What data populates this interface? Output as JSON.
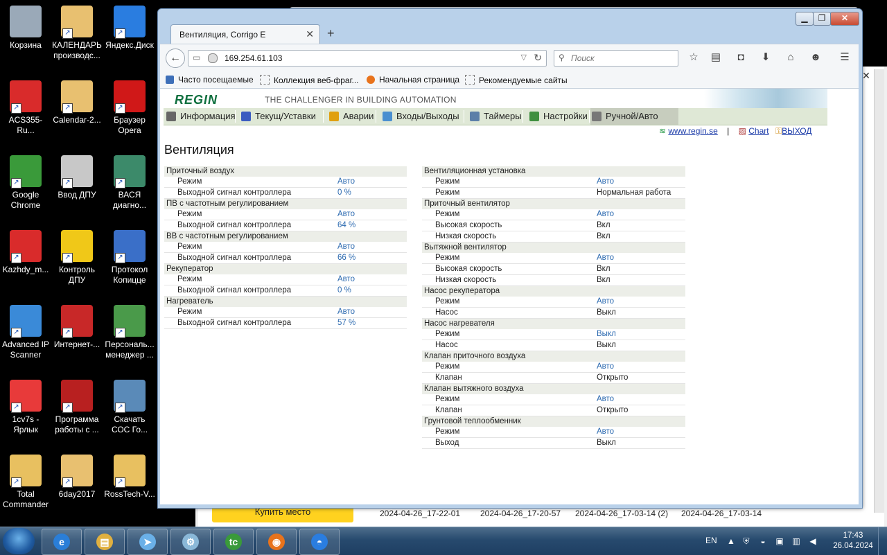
{
  "desktop": {
    "icons": [
      {
        "label": "Корзина",
        "icon": "recycle-bin-icon"
      },
      {
        "label": "КАЛЕНДАРЬ производс...",
        "icon": "calendar-file-icon"
      },
      {
        "label": "Яндекс.Диск",
        "icon": "yandex-disk-icon"
      },
      {
        "label": "ACS355-Ru...",
        "icon": "pdf-icon"
      },
      {
        "label": "Calendar-2...",
        "icon": "calendar-file-icon"
      },
      {
        "label": "Браузер Opera",
        "icon": "opera-icon"
      },
      {
        "label": "Google Chrome",
        "icon": "chrome-icon"
      },
      {
        "label": "Ввод ДПУ",
        "icon": "documents-icon"
      },
      {
        "label": "ВАСЯ диагно...",
        "icon": "vasya-diagnostics-icon"
      },
      {
        "label": "Kazhdy_m...",
        "icon": "pdf-icon"
      },
      {
        "label": "Контроль ДПУ",
        "icon": "bee-icon"
      },
      {
        "label": "Протокол Копицце",
        "icon": "word-document-icon"
      },
      {
        "label": "Advanced IP Scanner",
        "icon": "network-scanner-icon"
      },
      {
        "label": "Интернет-...",
        "icon": "internet-globe-icon"
      },
      {
        "label": "Персональ... менеджер ...",
        "icon": "personal-manager-icon"
      },
      {
        "label": "1cv7s - Ярлык",
        "icon": "1c-icon"
      },
      {
        "label": "Программа работы с ...",
        "icon": "program-icon"
      },
      {
        "label": "Скачать СОС Го...",
        "icon": "download-icon"
      },
      {
        "label": "Total Commander",
        "icon": "folder-icon"
      },
      {
        "label": "6day2017",
        "icon": "calendar-file-icon"
      },
      {
        "label": "RossTech-V...",
        "icon": "zip-folder-icon"
      }
    ]
  },
  "background_window": {
    "buy_button": "Купить место",
    "stamps": [
      "2024-04-26_17-22-01",
      "2024-04-26_17-20-57",
      "2024-04-26_17-03-14 (2)",
      "2024-04-26_17-03-14"
    ]
  },
  "browser": {
    "tab_title": "Вентиляция, Corrigo E",
    "url": "169.254.61.103",
    "search_placeholder": "Поиск",
    "bookmarks": [
      "Часто посещаемые",
      "Коллекция веб-фраг...",
      "Начальная страница",
      "Рекомендуемые сайты"
    ]
  },
  "regin": {
    "logo": "REGIN",
    "tagline": "THE CHALLENGER IN BUILDING AUTOMATION",
    "menu": [
      "Информация",
      "Текущ/Уставки",
      "Аварии",
      "Входы/Выходы",
      "Таймеры",
      "Настройки",
      "Ручной/Авто"
    ],
    "links": {
      "site": "www.regin.se",
      "chart": "Chart",
      "exit": "ВЫХОД"
    }
  },
  "page": {
    "title": "Вентиляция",
    "left": [
      {
        "section": "Приточный воздух",
        "rows": [
          {
            "k": "Режим",
            "v": "Авто",
            "link": true
          },
          {
            "k": "Выходной сигнал контроллера",
            "v": "0 %",
            "link": true
          }
        ]
      },
      {
        "section": "ПВ с частотным регулированием",
        "rows": [
          {
            "k": "Режим",
            "v": "Авто",
            "link": true
          },
          {
            "k": "Выходной сигнал контроллера",
            "v": "64 %",
            "link": true
          }
        ]
      },
      {
        "section": "ВВ с частотным регулированием",
        "rows": [
          {
            "k": "Режим",
            "v": "Авто",
            "link": true
          },
          {
            "k": "Выходной сигнал контроллера",
            "v": "66 %",
            "link": true
          }
        ]
      },
      {
        "section": "Рекуператор",
        "rows": [
          {
            "k": "Режим",
            "v": "Авто",
            "link": true
          },
          {
            "k": "Выходной сигнал контроллера",
            "v": "0 %",
            "link": true
          }
        ]
      },
      {
        "section": "Нагреватель",
        "rows": [
          {
            "k": "Режим",
            "v": "Авто",
            "link": true
          },
          {
            "k": "Выходной сигнал контроллера",
            "v": "57 %",
            "link": true
          }
        ]
      }
    ],
    "right": [
      {
        "section": "Вентиляционная установка",
        "rows": [
          {
            "k": "Режим",
            "v": "Авто",
            "link": true
          },
          {
            "k": "Режим",
            "v": "Нормальная работа",
            "link": false
          }
        ]
      },
      {
        "section": "Приточный вентилятор",
        "rows": [
          {
            "k": "Режим",
            "v": "Авто",
            "link": true
          },
          {
            "k": "Высокая скорость",
            "v": "Вкл",
            "link": false
          },
          {
            "k": "Низкая скорость",
            "v": "Вкл",
            "link": false
          }
        ]
      },
      {
        "section": "Вытяжной вентилятор",
        "rows": [
          {
            "k": "Режим",
            "v": "Авто",
            "link": true
          },
          {
            "k": "Высокая скорость",
            "v": "Вкл",
            "link": false
          },
          {
            "k": "Низкая скорость",
            "v": "Вкл",
            "link": false
          }
        ]
      },
      {
        "section": "Насос рекуператора",
        "rows": [
          {
            "k": "Режим",
            "v": "Авто",
            "link": true
          },
          {
            "k": "Насос",
            "v": "Выкл",
            "link": false
          }
        ]
      },
      {
        "section": "Насос нагревателя",
        "rows": [
          {
            "k": "Режим",
            "v": "Выкл",
            "link": true
          },
          {
            "k": "Насос",
            "v": "Выкл",
            "link": false
          }
        ]
      },
      {
        "section": "Клапан приточного воздуха",
        "rows": [
          {
            "k": "Режим",
            "v": "Авто",
            "link": true
          },
          {
            "k": "Клапан",
            "v": "Открыто",
            "link": false
          }
        ]
      },
      {
        "section": "Клапан вытяжного воздуха",
        "rows": [
          {
            "k": "Режим",
            "v": "Авто",
            "link": true
          },
          {
            "k": "Клапан",
            "v": "Открыто",
            "link": false
          }
        ]
      },
      {
        "section": "Грунтовой теплообменник",
        "rows": [
          {
            "k": "Режим",
            "v": "Авто",
            "link": true
          },
          {
            "k": "Выход",
            "v": "Выкл",
            "link": false
          }
        ]
      }
    ]
  },
  "taskbar": {
    "apps": [
      "internet-explorer-icon",
      "file-explorer-icon",
      "mail-plane-icon",
      "network-tool-icon",
      "total-commander-icon",
      "firefox-icon",
      "yandex-disk-icon"
    ],
    "lang": "EN",
    "time": "17:43",
    "date": "26.04.2024"
  }
}
